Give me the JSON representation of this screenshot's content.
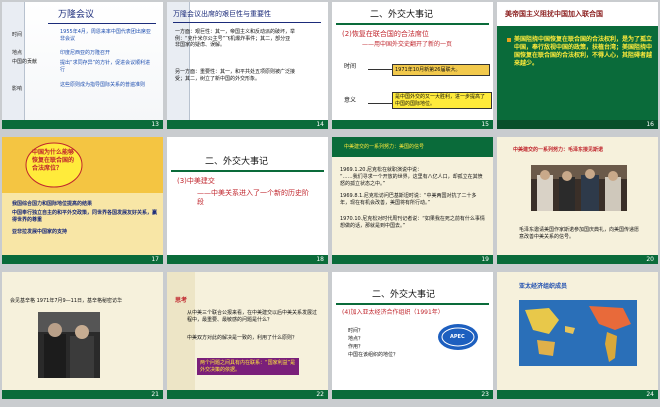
{
  "slides": [
    {
      "num": "13",
      "title": "万隆会议",
      "rows": [
        {
          "label": "时间",
          "text": "1955年4月，周恩来率中国代表团出席亚非会议"
        },
        {
          "label": "地点",
          "text": "印度尼西亚的万隆召开"
        },
        {
          "label": "中国的贡献",
          "text": "提出“求同存异”的方针，促进会议顺利进行"
        },
        {
          "label": "影响",
          "text": "这些原则成为指导国际关系的普遍准则"
        }
      ]
    },
    {
      "num": "14",
      "title": "万隆会议出席的艰巨性与重要性",
      "p1": "一方面：艰巨性：其一，帝国主义和反动派的破坏，举例：“克什米尔公主号”飞机爆炸事件；其二，部分亚非国家的疑虑、误解。",
      "p2": "另一方面：重要性：其一，和平共处五项原则被广泛接受；其二，树立了新中国的外交形象。"
    },
    {
      "num": "15",
      "title": "二、外交大事记",
      "sub": "(2)恢复在联合国的合法席位",
      "subsub": "——用中国外交史翻开了新的一页",
      "k1": "时间",
      "v1": "1971年10月新第26届联大。",
      "k2": "意义",
      "v2": "是中国外交的又一大胜利，进一步提高了中国的国际地位。"
    },
    {
      "num": "16",
      "title": "美帝国主义阻扰中国加入联合国",
      "body": "美国阻挠中国恢复在联合国的合法权利，是为了孤立中国，奉行敌视中国的政策，扶植台湾；美国阻挠中国恢复在联合国的合法权利，不得人心，其阻碍者越来越少。"
    },
    {
      "num": "17",
      "bubble": "中国为什么能够恢复在联合国的合法席位？",
      "bullets": [
        "我国综合国力和国际地位提高的结果",
        "中国奉行独立自主的和平外交政策，同世界各国发展友好关系，赢得世界的尊重",
        "亚非拉发展中国家的支持"
      ]
    },
    {
      "num": "18",
      "title": "二、外交大事记",
      "sub": "(3)中美建交",
      "subsub": "——中美关系进入了一个新的历史阶段"
    },
    {
      "num": "19",
      "title": "中美建交的一系列努力：美国的信号",
      "lines": [
        "1969.1.20.尼克松在就职演说中说：",
        "“……我们寻求一个开放的世界，这里有八亿人口，却孤立在其愤怒的孤立状态之中。”",
        "1969.8.1.尼克松访问巴基斯坦时说：“中美两国对抗了二十多年，现在有机会改善，美国将有所行动。”",
        "1970.10.尼克松对时代周刊记者说：“如果我在死之前有什么事情想做的话，那就是到中国去。”"
      ]
    },
    {
      "num": "20",
      "title": "中美建交的一系列努力：毛泽东接见斯诺",
      "caption": "毛泽东邀请美国作家斯诺参加国庆典礼，向美国传递愿意改善中美关系的信号。"
    },
    {
      "num": "21",
      "caption": "会见基辛格 1971年7月9—11日，基辛格秘密访华"
    },
    {
      "num": "22",
      "title": "思考",
      "lines": [
        "从中美三个联合公报来看，在中美建交以后中美关系发展过程中，最重要、最敏感的问题是什么？",
        "中美双方对此的解决是一致的，利用了什么原则？"
      ],
      "box": "两个问题之间具有内在联系：“国家利益”是外交决策的依据。"
    },
    {
      "num": "23",
      "title": "二、外交大事记",
      "sub": "(4)加入亚太经济合作组织（1991年）",
      "bullets": [
        "时间？",
        "地点？",
        "作用？",
        "中国在该组织的地位？"
      ],
      "logo": "APEC"
    },
    {
      "num": "24",
      "title": "亚太经济组织成员"
    }
  ],
  "colors": {
    "green": "#0a6b3a",
    "navy": "#1b2b7a",
    "blue": "#1f4fb0",
    "red": "#c0262d",
    "orange": "#e8a11c",
    "darkred": "#8a1d1d"
  }
}
